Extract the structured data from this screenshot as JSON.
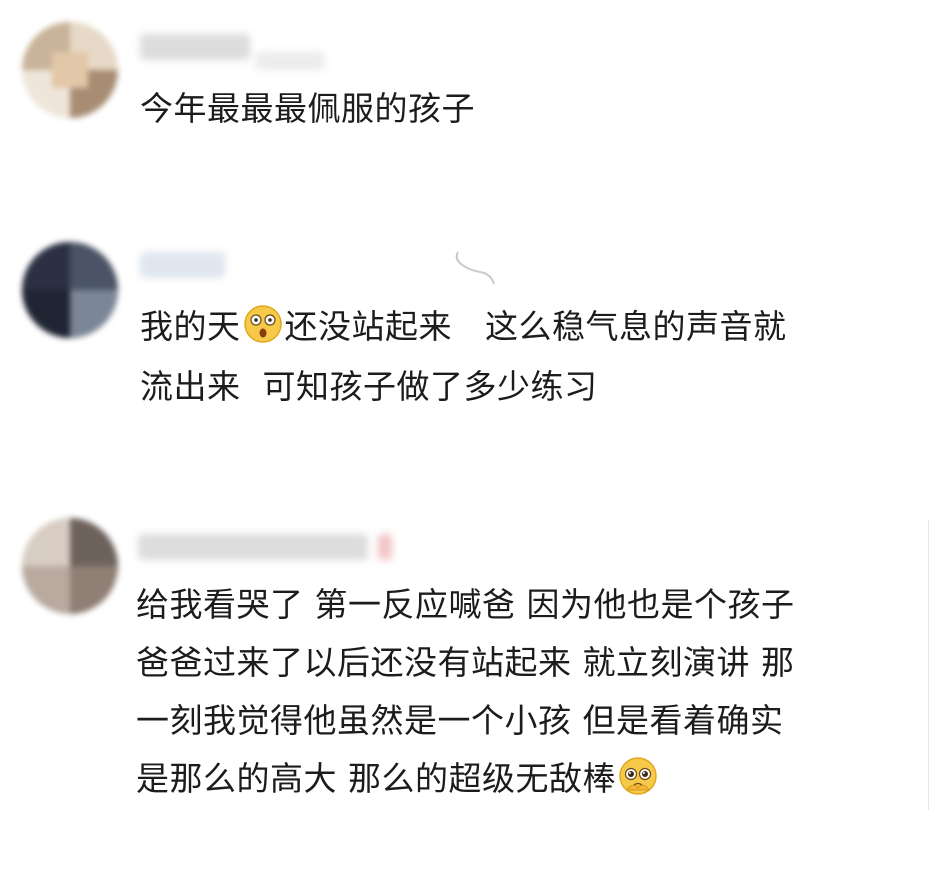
{
  "comments": [
    {
      "text_lines": [
        "今年最最最佩服的孩子"
      ],
      "username_redacted": true,
      "avatar_colors": [
        "#c9b39a",
        "#e7d9c7",
        "#a88d73"
      ]
    },
    {
      "text_line_1_part_1": "我的天",
      "emoji_1": "astonished-face-emoji",
      "text_line_1_part_2": "还没站起来   这么稳气息的声音就",
      "text_line_2": "流出来  可知孩子做了多少练习",
      "username_redacted": true,
      "avatar_colors": [
        "#2b3143",
        "#4a5466",
        "#7b8696"
      ]
    },
    {
      "text_line_1": "给我看哭了 第一反应喊爸 因为他也是个孩子",
      "text_line_2": "爸爸过来了以后还没有站起来 就立刻演讲 那",
      "text_line_3": "一刻我觉得他虽然是一个小孩 但是看着确实",
      "text_line_4": "是那么的高大 那么的超级无敌棒",
      "emoji_2": "pleading-face-emoji",
      "username_redacted": true,
      "avatar_colors": [
        "#b9aaa0",
        "#6e625c",
        "#d8cdc3"
      ]
    }
  ],
  "colors": {
    "text": "#1c1c1c",
    "background": "#ffffff",
    "redaction": "#d9d9d9",
    "redaction_accent": "#f2c4c4"
  }
}
